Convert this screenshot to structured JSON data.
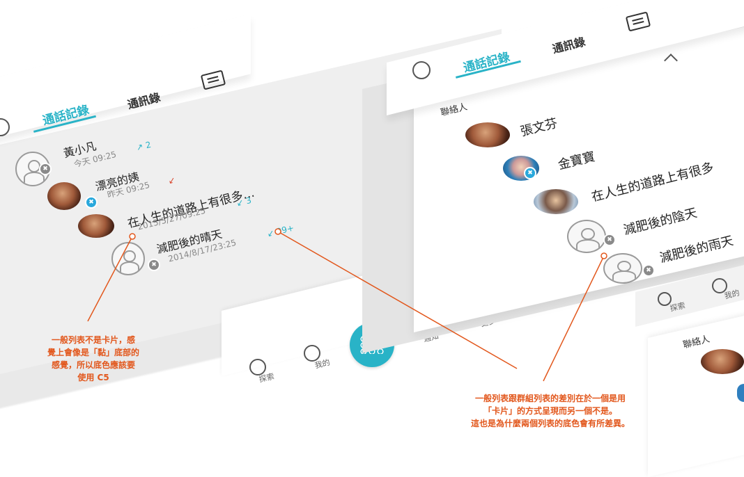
{
  "left_screen": {
    "tabs": [
      {
        "label": "通話記錄",
        "active": true
      },
      {
        "label": "通訊錄",
        "active": false
      }
    ],
    "list": [
      {
        "name": "黃小凡",
        "time": "今天 09:25",
        "count": "↗ 2",
        "count_color": "blue",
        "avatar": "empty"
      },
      {
        "name": "漂亮的姨",
        "time": "昨天 09:25",
        "count": "↙",
        "count_color": "red",
        "avatar": "face"
      },
      {
        "name": "在人生的道路上有很多…",
        "time": "2015/5/27/09:25",
        "count": "↙ 3",
        "count_color": "blue",
        "avatar": "face"
      },
      {
        "name": "減肥後的晴天",
        "time": "2014/8/17/23:25",
        "count": "↙ 99+",
        "count_color": "blue",
        "avatar": "empty"
      }
    ],
    "tabbar": [
      {
        "label": "探索",
        "icon": "compass-icon"
      },
      {
        "label": "我的",
        "icon": "profile-icon"
      },
      {
        "label": "",
        "icon": "dialpad-icon"
      },
      {
        "label": "通知",
        "icon": "bell-icon"
      },
      {
        "label": "更多",
        "icon": "more-icon"
      }
    ]
  },
  "right_screen": {
    "tabs": [
      {
        "label": "通話記錄",
        "active": true
      },
      {
        "label": "通訊錄",
        "active": false
      }
    ],
    "section_title": "聯絡人",
    "contacts": [
      {
        "name": "張文芬",
        "avatar": "face"
      },
      {
        "name": "金寶寶",
        "avatar": "blue"
      },
      {
        "name": "在人生的道路上有很多",
        "avatar": "sun"
      },
      {
        "name": "減肥後的陰天",
        "avatar": "empty"
      },
      {
        "name": "減肥後的雨天",
        "avatar": "empty"
      }
    ],
    "tabbar": [
      {
        "label": "探索",
        "icon": "compass-icon"
      },
      {
        "label": "我的",
        "icon": "profile-icon"
      }
    ],
    "section_title_2": "聯絡人"
  },
  "annotations": {
    "left_note": [
      "一般列表不是卡片，感",
      "覺上會像是「黏」底部的",
      "感覺，所以底色應該要",
      "使用 C5"
    ],
    "right_note": [
      "一般列表跟群組列表的差別在於一個是用",
      "「卡片」的方式呈現而另一個不是。",
      "這也是為什麼兩個列表的底色會有所差異。"
    ]
  },
  "colors": {
    "accent": "#29b3c7",
    "annotation": "#e2571c",
    "missed": "#d9432a"
  }
}
